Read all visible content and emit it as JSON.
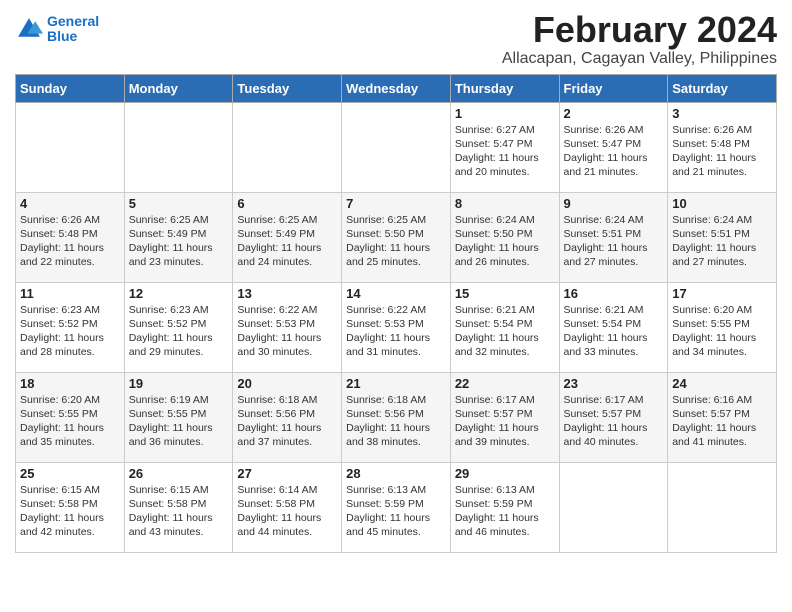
{
  "logo": {
    "line1": "General",
    "line2": "Blue"
  },
  "title": "February 2024",
  "subtitle": "Allacapan, Cagayan Valley, Philippines",
  "weekdays": [
    "Sunday",
    "Monday",
    "Tuesday",
    "Wednesday",
    "Thursday",
    "Friday",
    "Saturday"
  ],
  "weeks": [
    [
      {
        "day": "",
        "info": ""
      },
      {
        "day": "",
        "info": ""
      },
      {
        "day": "",
        "info": ""
      },
      {
        "day": "",
        "info": ""
      },
      {
        "day": "1",
        "info": "Sunrise: 6:27 AM\nSunset: 5:47 PM\nDaylight: 11 hours\nand 20 minutes."
      },
      {
        "day": "2",
        "info": "Sunrise: 6:26 AM\nSunset: 5:47 PM\nDaylight: 11 hours\nand 21 minutes."
      },
      {
        "day": "3",
        "info": "Sunrise: 6:26 AM\nSunset: 5:48 PM\nDaylight: 11 hours\nand 21 minutes."
      }
    ],
    [
      {
        "day": "4",
        "info": "Sunrise: 6:26 AM\nSunset: 5:48 PM\nDaylight: 11 hours\nand 22 minutes."
      },
      {
        "day": "5",
        "info": "Sunrise: 6:25 AM\nSunset: 5:49 PM\nDaylight: 11 hours\nand 23 minutes."
      },
      {
        "day": "6",
        "info": "Sunrise: 6:25 AM\nSunset: 5:49 PM\nDaylight: 11 hours\nand 24 minutes."
      },
      {
        "day": "7",
        "info": "Sunrise: 6:25 AM\nSunset: 5:50 PM\nDaylight: 11 hours\nand 25 minutes."
      },
      {
        "day": "8",
        "info": "Sunrise: 6:24 AM\nSunset: 5:50 PM\nDaylight: 11 hours\nand 26 minutes."
      },
      {
        "day": "9",
        "info": "Sunrise: 6:24 AM\nSunset: 5:51 PM\nDaylight: 11 hours\nand 27 minutes."
      },
      {
        "day": "10",
        "info": "Sunrise: 6:24 AM\nSunset: 5:51 PM\nDaylight: 11 hours\nand 27 minutes."
      }
    ],
    [
      {
        "day": "11",
        "info": "Sunrise: 6:23 AM\nSunset: 5:52 PM\nDaylight: 11 hours\nand 28 minutes."
      },
      {
        "day": "12",
        "info": "Sunrise: 6:23 AM\nSunset: 5:52 PM\nDaylight: 11 hours\nand 29 minutes."
      },
      {
        "day": "13",
        "info": "Sunrise: 6:22 AM\nSunset: 5:53 PM\nDaylight: 11 hours\nand 30 minutes."
      },
      {
        "day": "14",
        "info": "Sunrise: 6:22 AM\nSunset: 5:53 PM\nDaylight: 11 hours\nand 31 minutes."
      },
      {
        "day": "15",
        "info": "Sunrise: 6:21 AM\nSunset: 5:54 PM\nDaylight: 11 hours\nand 32 minutes."
      },
      {
        "day": "16",
        "info": "Sunrise: 6:21 AM\nSunset: 5:54 PM\nDaylight: 11 hours\nand 33 minutes."
      },
      {
        "day": "17",
        "info": "Sunrise: 6:20 AM\nSunset: 5:55 PM\nDaylight: 11 hours\nand 34 minutes."
      }
    ],
    [
      {
        "day": "18",
        "info": "Sunrise: 6:20 AM\nSunset: 5:55 PM\nDaylight: 11 hours\nand 35 minutes."
      },
      {
        "day": "19",
        "info": "Sunrise: 6:19 AM\nSunset: 5:55 PM\nDaylight: 11 hours\nand 36 minutes."
      },
      {
        "day": "20",
        "info": "Sunrise: 6:18 AM\nSunset: 5:56 PM\nDaylight: 11 hours\nand 37 minutes."
      },
      {
        "day": "21",
        "info": "Sunrise: 6:18 AM\nSunset: 5:56 PM\nDaylight: 11 hours\nand 38 minutes."
      },
      {
        "day": "22",
        "info": "Sunrise: 6:17 AM\nSunset: 5:57 PM\nDaylight: 11 hours\nand 39 minutes."
      },
      {
        "day": "23",
        "info": "Sunrise: 6:17 AM\nSunset: 5:57 PM\nDaylight: 11 hours\nand 40 minutes."
      },
      {
        "day": "24",
        "info": "Sunrise: 6:16 AM\nSunset: 5:57 PM\nDaylight: 11 hours\nand 41 minutes."
      }
    ],
    [
      {
        "day": "25",
        "info": "Sunrise: 6:15 AM\nSunset: 5:58 PM\nDaylight: 11 hours\nand 42 minutes."
      },
      {
        "day": "26",
        "info": "Sunrise: 6:15 AM\nSunset: 5:58 PM\nDaylight: 11 hours\nand 43 minutes."
      },
      {
        "day": "27",
        "info": "Sunrise: 6:14 AM\nSunset: 5:58 PM\nDaylight: 11 hours\nand 44 minutes."
      },
      {
        "day": "28",
        "info": "Sunrise: 6:13 AM\nSunset: 5:59 PM\nDaylight: 11 hours\nand 45 minutes."
      },
      {
        "day": "29",
        "info": "Sunrise: 6:13 AM\nSunset: 5:59 PM\nDaylight: 11 hours\nand 46 minutes."
      },
      {
        "day": "",
        "info": ""
      },
      {
        "day": "",
        "info": ""
      }
    ]
  ]
}
